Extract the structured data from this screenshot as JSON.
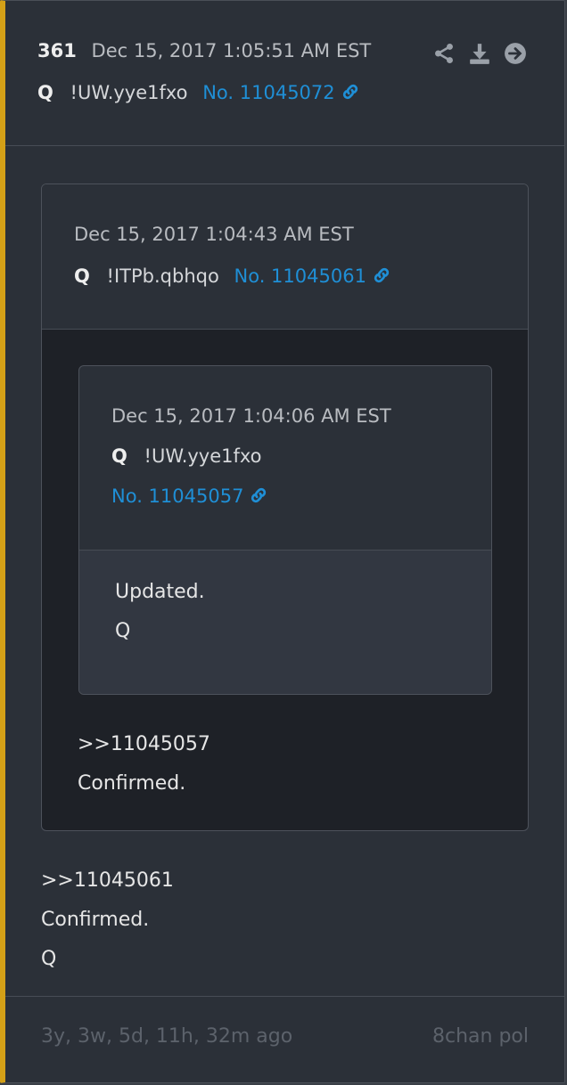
{
  "post": {
    "number": "361",
    "date": "Dec 15, 2017 1:05:51 AM EST",
    "author": "Q",
    "tripcode": "!UW.yye1fxo",
    "post_no": "No. 11045072",
    "icons": [
      "share-icon",
      "download-icon",
      "arrow-right-circle-icon"
    ],
    "text": ">>11045061\nConfirmed.\nQ"
  },
  "quote1": {
    "date": "Dec 15, 2017 1:04:43 AM EST",
    "author": "Q",
    "tripcode": "!ITPb.qbhqo",
    "post_no": "No. 11045061",
    "text": ">>11045057\nConfirmed."
  },
  "quote2": {
    "date": "Dec 15, 2017 1:04:06 AM EST",
    "author": "Q",
    "tripcode": "!UW.yye1fxo",
    "post_no": "No. 11045057",
    "text": "Updated.\nQ"
  },
  "footer": {
    "ago": "3y, 3w, 5d, 11h, 32m ago",
    "source": "8chan pol"
  },
  "colors": {
    "accent": "#d4a017",
    "link": "#1f8fd6",
    "background": "#2b3038"
  }
}
